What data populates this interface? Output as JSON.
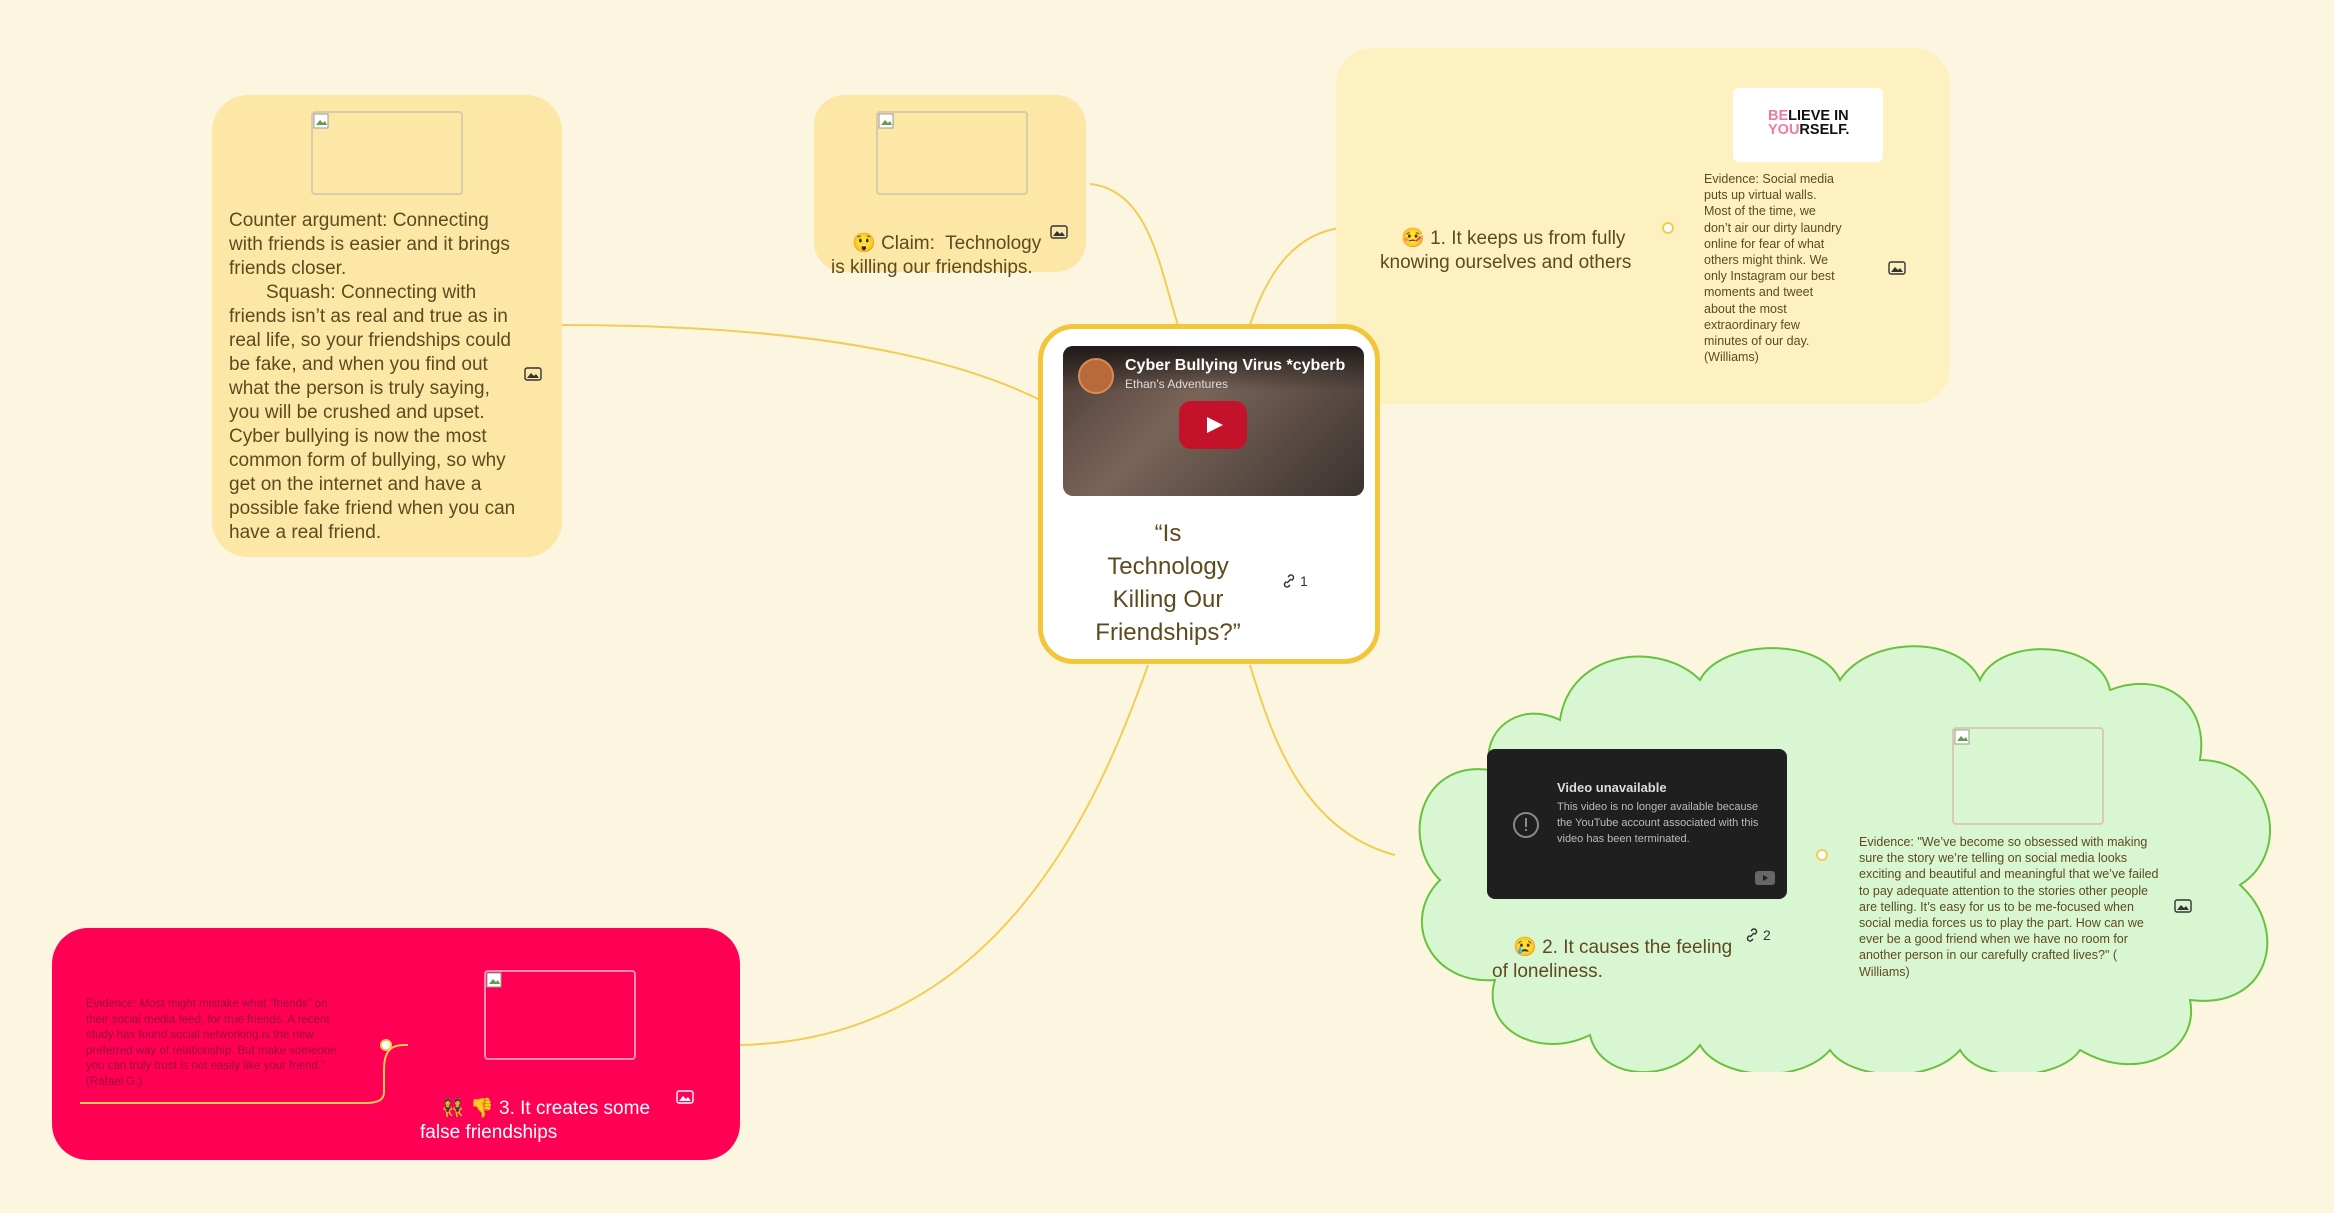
{
  "colors": {
    "background": "#fcf5e0",
    "connector": "#f2cd55",
    "central_border": "#f2c53a",
    "counter_card": "#fde7a6",
    "claim_card": "#fde7a6",
    "topic1_card": "#fef1c1",
    "topic2_cloud": "#d9f6d3",
    "topic2_border": "#67c23d",
    "topic3_card": "#ff0054"
  },
  "central": {
    "title": "“Is Technology Killing Our Friendships?”",
    "link_count": "1",
    "video": {
      "title": "Cyber Bullying Virus *cyberb",
      "channel": "Ethan's Adventures"
    }
  },
  "counter": {
    "text": "Counter argument: Connecting with friends is easier and it brings friends closer.\n       Squash: Connecting with friends isn’t as real and true as in real life, so your friendships could be fake, and when you find out what the person is truly saying, you will be crushed and upset. Cyber bullying is now the most common form of bullying, so why get on the internet and have a possible fake friend when you can have a real friend."
  },
  "claim": {
    "emoji": "😲",
    "text": "Claim:  Technology is killing our friendships."
  },
  "topic1": {
    "emoji": "🤒",
    "text": "1. It keeps us from fully knowing ourselves and others",
    "logo_line1_a": "BE",
    "logo_line1_b": "LIEVE IN",
    "logo_line2_a": "YOU",
    "logo_line2_b": "RSELF.",
    "evidence": "Evidence: Social media puts up virtual walls. Most of the time, we don’t air our dirty laundry online for fear of what others might think. We only Instagram our best moments and tweet about the most extraordinary few minutes of our day. (Williams)"
  },
  "topic2": {
    "emoji": "😢",
    "text": "2. It causes the feeling of loneliness.",
    "link_count": "2",
    "video": {
      "title": "Video unavailable",
      "message": "This video is no longer available because the YouTube account associated with this video has been terminated."
    },
    "evidence": "Evidence: \"We’ve become so obsessed with making sure the story we’re telling on social media looks exciting and beautiful and meaningful that we’ve failed to pay adequate attention to the stories other people are telling. It’s easy for us to be me-focused when social media forces us to play the part. How can we ever be a good friend when we have no room for another person in our carefully crafted lives?\" ( Williams)"
  },
  "topic3": {
    "emoji": "👯 👎",
    "text": "3. It creates some false friendships",
    "evidence": "Evidence: Most might mistake what “friends” on their social media feed, for true friends. A recent study has found social networking is the new preferred way of relationship. But make someone you can truly trust is not easily like your friend.” (Rafael G.)"
  }
}
